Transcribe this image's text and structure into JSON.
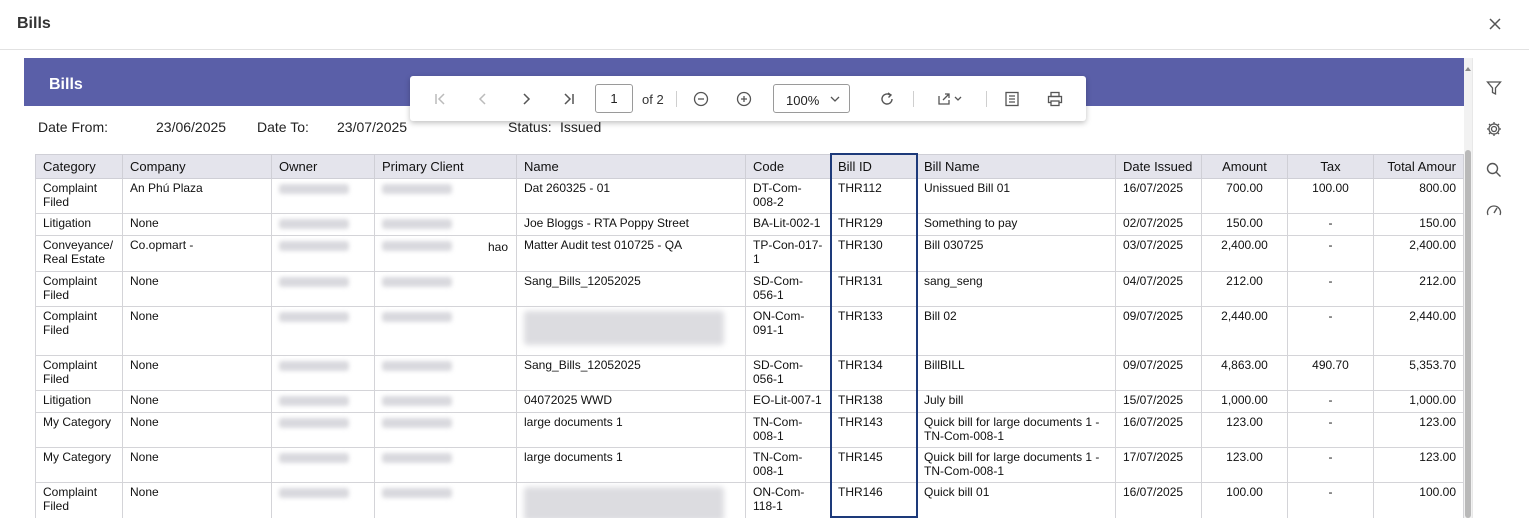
{
  "dialog": {
    "title": "Bills",
    "close_icon": "close-icon"
  },
  "report": {
    "title": "Bills",
    "filters": {
      "date_from_label": "Date From:",
      "date_from_value": "23/06/2025",
      "date_to_label": "Date To:",
      "date_to_value": "23/07/2025",
      "status_label": "Status:",
      "status_value": "Issued"
    },
    "columns": [
      "Category",
      "Company",
      "Owner",
      "Primary Client",
      "Name",
      "Code",
      "Bill ID",
      "Bill Name",
      "Date Issued",
      "Amount",
      "Tax",
      "Total Amour"
    ],
    "rows": [
      {
        "category": "Complaint Filed",
        "company": "An Phú Plaza",
        "name": "Dat 260325 - 01",
        "code": "DT-Com-008-2",
        "bill_id": "THR112",
        "bill_name": "Unissued Bill 01",
        "date": "16/07/2025",
        "amount": "700.00",
        "tax": "100.00",
        "total": "800.00"
      },
      {
        "category": "Litigation",
        "company": "None",
        "name": "Joe Bloggs - RTA Poppy Street",
        "code": "BA-Lit-002-1",
        "bill_id": "THR129",
        "bill_name": "Something to pay",
        "date": "02/07/2025",
        "amount": "150.00",
        "tax": "-",
        "total": "150.00"
      },
      {
        "category": "Conveyance/ Real Estate",
        "company": "Co.opmart  -",
        "client_suffix": "hao",
        "name": "Matter Audit test 010725 - QA",
        "code": "TP-Con-017-1",
        "bill_id": "THR130",
        "bill_name": "Bill 030725",
        "date": "03/07/2025",
        "amount": "2,400.00",
        "tax": "-",
        "total": "2,400.00"
      },
      {
        "category": "Complaint Filed",
        "company": "None",
        "name": "Sang_Bills_12052025",
        "code": "SD-Com-056-1",
        "bill_id": "THR131",
        "bill_name": "sang_seng",
        "date": "04/07/2025",
        "amount": "212.00",
        "tax": "-",
        "total": "212.00"
      },
      {
        "category": "Complaint Filed",
        "company": "None",
        "name": "",
        "code": "ON-Com-091-1",
        "bill_id": "THR133",
        "bill_name": "Bill 02",
        "date": "09/07/2025",
        "amount": "2,440.00",
        "tax": "-",
        "total": "2,440.00"
      },
      {
        "category": "Complaint Filed",
        "company": "None",
        "name": "Sang_Bills_12052025",
        "code": "SD-Com-056-1",
        "bill_id": "THR134",
        "bill_name": "BillBILL",
        "date": "09/07/2025",
        "amount": "4,863.00",
        "tax": "490.70",
        "total": "5,353.70"
      },
      {
        "category": "Litigation",
        "company": "None",
        "name": "04072025 WWD",
        "code": "EO-Lit-007-1",
        "bill_id": "THR138",
        "bill_name": "July bill",
        "date": "15/07/2025",
        "amount": "1,000.00",
        "tax": "-",
        "total": "1,000.00"
      },
      {
        "category": "My Category",
        "company": "None",
        "name": "large documents 1",
        "code": "TN-Com-008-1",
        "bill_id": "THR143",
        "bill_name": "Quick bill for large documents 1 - TN-Com-008-1",
        "date": "16/07/2025",
        "amount": "123.00",
        "tax": "-",
        "total": "123.00"
      },
      {
        "category": "My Category",
        "company": "None",
        "name": "large documents 1",
        "code": "TN-Com-008-1",
        "bill_id": "THR145",
        "bill_name": "Quick bill for large documents 1 - TN-Com-008-1",
        "date": "17/07/2025",
        "amount": "123.00",
        "tax": "-",
        "total": "123.00"
      },
      {
        "category": "Complaint Filed",
        "company": "None",
        "name": "",
        "code": "ON-Com-118-1",
        "bill_id": "THR146",
        "bill_name": "Quick bill 01",
        "date": "16/07/2025",
        "amount": "100.00",
        "tax": "-",
        "total": "100.00"
      }
    ]
  },
  "toolbar": {
    "page_value": "1",
    "page_of": "of 2",
    "zoom_value": "100%",
    "icons": [
      "first-page-icon",
      "prev-page-icon",
      "next-page-icon",
      "last-page-icon",
      "zoom-out-icon",
      "zoom-in-icon",
      "refresh-icon",
      "export-icon",
      "document-map-icon",
      "print-icon"
    ]
  },
  "side_panel": {
    "icons": [
      "filter-icon",
      "settings-icon",
      "search-icon",
      "gauge-icon"
    ]
  }
}
